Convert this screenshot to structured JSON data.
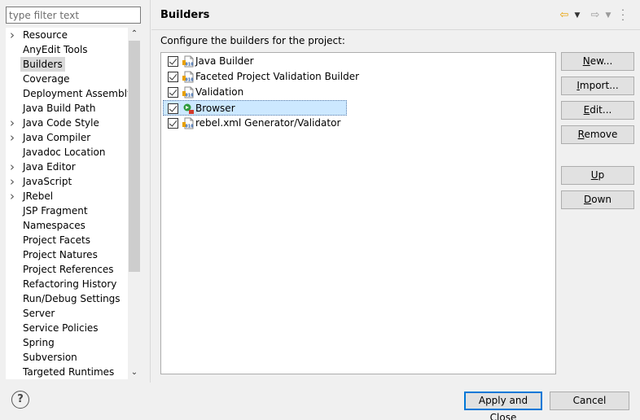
{
  "filter": {
    "placeholder": "type filter text",
    "value": ""
  },
  "tree": {
    "items": [
      {
        "label": "Resource",
        "expandable": true,
        "selected": false
      },
      {
        "label": "AnyEdit Tools",
        "expandable": false,
        "selected": false
      },
      {
        "label": "Builders",
        "expandable": false,
        "selected": true
      },
      {
        "label": "Coverage",
        "expandable": false,
        "selected": false
      },
      {
        "label": "Deployment Assembly",
        "expandable": false,
        "selected": false
      },
      {
        "label": "Java Build Path",
        "expandable": false,
        "selected": false
      },
      {
        "label": "Java Code Style",
        "expandable": true,
        "selected": false
      },
      {
        "label": "Java Compiler",
        "expandable": true,
        "selected": false
      },
      {
        "label": "Javadoc Location",
        "expandable": false,
        "selected": false
      },
      {
        "label": "Java Editor",
        "expandable": true,
        "selected": false
      },
      {
        "label": "JavaScript",
        "expandable": true,
        "selected": false
      },
      {
        "label": "JRebel",
        "expandable": true,
        "selected": false
      },
      {
        "label": "JSP Fragment",
        "expandable": false,
        "selected": false
      },
      {
        "label": "Namespaces",
        "expandable": false,
        "selected": false
      },
      {
        "label": "Project Facets",
        "expandable": false,
        "selected": false
      },
      {
        "label": "Project Natures",
        "expandable": false,
        "selected": false
      },
      {
        "label": "Project References",
        "expandable": false,
        "selected": false
      },
      {
        "label": "Refactoring History",
        "expandable": false,
        "selected": false
      },
      {
        "label": "Run/Debug Settings",
        "expandable": false,
        "selected": false
      },
      {
        "label": "Server",
        "expandable": false,
        "selected": false
      },
      {
        "label": "Service Policies",
        "expandable": false,
        "selected": false
      },
      {
        "label": "Spring",
        "expandable": false,
        "selected": false
      },
      {
        "label": "Subversion",
        "expandable": false,
        "selected": false
      },
      {
        "label": "Targeted Runtimes",
        "expandable": false,
        "selected": false
      }
    ]
  },
  "page": {
    "title": "Builders",
    "description": "Configure the builders for the project:"
  },
  "builders": [
    {
      "label": "Java Builder",
      "checked": true,
      "icon": "binary-builder-icon",
      "selected": false
    },
    {
      "label": "Faceted Project Validation Builder",
      "checked": true,
      "icon": "binary-builder-icon",
      "selected": false
    },
    {
      "label": "Validation",
      "checked": true,
      "icon": "binary-builder-icon",
      "selected": false
    },
    {
      "label": "Browser",
      "checked": true,
      "icon": "external-tool-builder-icon",
      "selected": true
    },
    {
      "label": "rebel.xml Generator/Validator",
      "checked": true,
      "icon": "binary-builder-icon",
      "selected": false
    }
  ],
  "buttons": {
    "new": {
      "mnemonic": "N",
      "rest": "ew..."
    },
    "import": {
      "mnemonic": "I",
      "rest": "mport..."
    },
    "edit": {
      "mnemonic": "E",
      "rest": "dit..."
    },
    "remove": {
      "mnemonic": "R",
      "rest": "emove"
    },
    "up": {
      "mnemonic": "U",
      "rest": "p"
    },
    "down": {
      "mnemonic": "D",
      "rest": "own"
    }
  },
  "footer": {
    "help": "?",
    "apply_close": "Apply and Close",
    "cancel": "Cancel"
  },
  "colors": {
    "selection": "#cce8ff",
    "tree_selection": "#d9d9d9",
    "default_button_border": "#0078d7",
    "nav_arrow": "#e8a000"
  }
}
